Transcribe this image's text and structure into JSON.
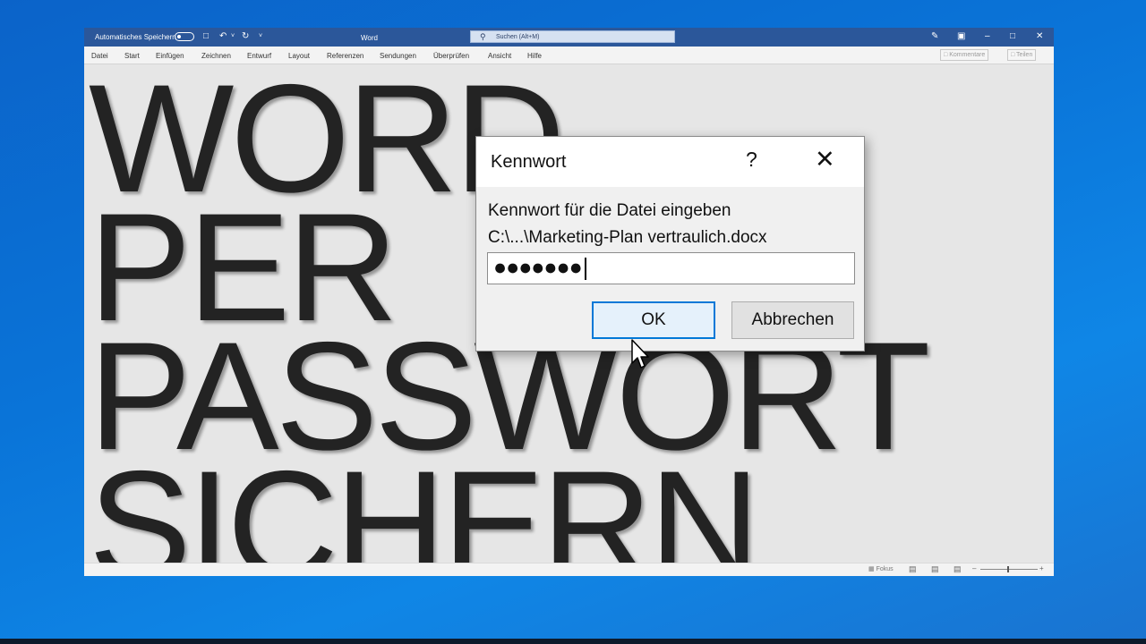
{
  "window": {
    "autosave_label": "Automatisches Speichern",
    "app_title": "Word",
    "search_placeholder": "Suchen (Alt+M)"
  },
  "ribbon": {
    "tabs": [
      "Datei",
      "Start",
      "Einfügen",
      "Zeichnen",
      "Entwurf",
      "Layout",
      "Referenzen",
      "Sendungen",
      "Überprüfen",
      "Ansicht",
      "Hilfe"
    ],
    "comments_label": "Kommentare",
    "share_label": "Teilen"
  },
  "document": {
    "lines": [
      "WORD",
      "PER",
      "PASSWORT",
      "SICHERN"
    ]
  },
  "statusbar": {
    "focus_label": "Fokus"
  },
  "dialog": {
    "title": "Kennwort",
    "help": "?",
    "close": "✕",
    "prompt": "Kennwort für die Datei eingeben",
    "file_path": "C:\\...\\Marketing-Plan vertraulich.docx",
    "password_mask": "●●●●●●●",
    "ok_label": "OK",
    "cancel_label": "Abbrechen"
  },
  "colors": {
    "title_bar": "#2b579a",
    "desktop": "#0a74d8",
    "ok_border": "#0078d7"
  }
}
